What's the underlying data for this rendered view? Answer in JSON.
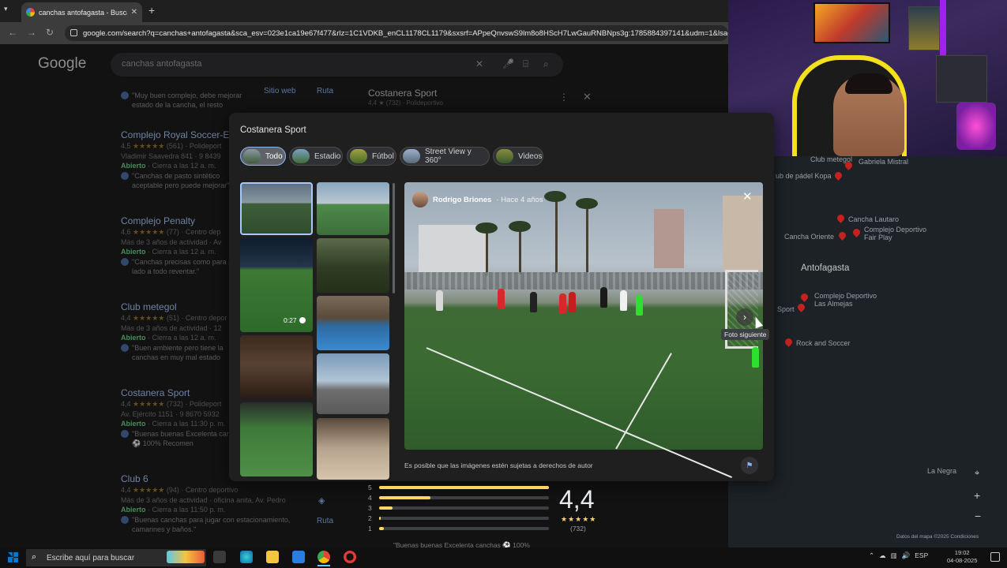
{
  "browser": {
    "tab_title": "canchas antofagasta - Buscar co",
    "url": "google.com/search?q=canchas+antofagasta&sca_esv=023e1ca19e67f477&rlz=1C1VDKB_enCL1178CL1179&sxsrf=APpeQnvswS9lm8o8HScH7LwGauRNBNps3g:1785884397141&udm=1&lsack=7W5"
  },
  "search": {
    "logo": "Google",
    "query": "canchas antofagasta"
  },
  "results": [
    {
      "name": "",
      "line1": "",
      "open": "",
      "close": "",
      "review": "\"Muy buen complejo, debe mejorar estado de la cancha, el resto"
    },
    {
      "name": "Complejo Royal Soccer-E",
      "rating": "4,5",
      "stars": "★★★★★",
      "count": "(561)",
      "type": "Polideport",
      "line2": "Vladimir Saavedra 841 · 9 8439",
      "open": "Abierto",
      "close": "· Cierra a las 12 a. m.",
      "review": "\"Canchas de pasto sintético aceptable pero puede mejorar\""
    },
    {
      "name": "Complejo Penalty",
      "rating": "4,6",
      "stars": "★★★★★",
      "count": "(77)",
      "type": "Centro dep",
      "line2": "Más de 3 años de actividad · Av",
      "open": "Abierto",
      "close": "· Cierra a las 12 a. m.",
      "review": "\"Canchas precisas como para por lado a todo reventar.\""
    },
    {
      "name": "Club metegol",
      "rating": "4,4",
      "stars": "★★★★★",
      "count": "(51)",
      "type": "Centro depor",
      "line2": "Más de 3 años de actividad · 12",
      "open": "Abierto",
      "close": "· Cierra a las 12 a. m.",
      "review": "\"Buen ambiente pero tiene la canchas en muy mal estado"
    },
    {
      "name": "Costanera Sport",
      "rating": "4,4",
      "stars": "★★★★★",
      "count": "(732)",
      "type": "Polideport",
      "line2": "Av. Ejército 1151 · 9 8670 5932",
      "open": "Abierto",
      "close": "· Cierra a las 11:30 p. m.",
      "review": "\"Buenas buenas Excelenta canchas ⚽ 100% Recomen"
    },
    {
      "name": "Club 6",
      "rating": "4,4",
      "stars": "★★★★★",
      "count": "(94)",
      "type": "Centro deportivo",
      "line2": "Más de 3 años de actividad · oficina anita, Av. Pedro",
      "open": "Abierto",
      "close": "· Cierra a las 11:50 p. m.",
      "review": "\"Buenas canchas para jugar con estacionamiento, camarines y baños.\""
    }
  ],
  "result_actions": {
    "website": "Sitio web",
    "route": "Ruta"
  },
  "place_panel": {
    "title": "Costanera Sport",
    "sub": "4,4 ★ (732) · Polideportivo"
  },
  "modal": {
    "title": "Costanera Sport",
    "chips": [
      {
        "label": "Todo"
      },
      {
        "label": "Estadio"
      },
      {
        "label": "Fútbol"
      },
      {
        "label": "Street View y 360°"
      },
      {
        "label": "Videos"
      }
    ],
    "video_duration": "0:27",
    "photo_author": "Rodrigo Briones",
    "photo_age": "· Hace 4 años",
    "next_tooltip": "Foto siguiente",
    "copyright": "Es posible que las imágenes estén sujetas a derechos de autor"
  },
  "ratings": {
    "score": "4,4",
    "stars": "★★★★★",
    "count": "(732)",
    "rows": [
      {
        "label": "5",
        "fraction": 1.0
      },
      {
        "label": "4",
        "fraction": 0.3
      },
      {
        "label": "3",
        "fraction": 0.08
      },
      {
        "label": "2",
        "fraction": 0.01
      },
      {
        "label": "1",
        "fraction": 0.03
      }
    ],
    "footer_quote": "\"Buenas buenas Excelenta canchas ⚽ 100%"
  },
  "map": {
    "city": "Antofagasta",
    "places": [
      "Club metegol",
      "Gabriela Mistral",
      "ub de pádel Kopa",
      "Cancha Lautaro",
      "Cancha Oriente",
      "Complejo Deportivo Fair Play",
      "Complejo Deportivo Las Almejas",
      "Sport",
      "Rock and Soccer"
    ],
    "other_label": "La Negra",
    "attribution": "Datos del mapa ©2025    Condiciones"
  },
  "taskbar": {
    "search_placeholder": "Escribe aquí para buscar",
    "lang": "ESP",
    "time": "19:02",
    "date": "04-08-2025"
  }
}
